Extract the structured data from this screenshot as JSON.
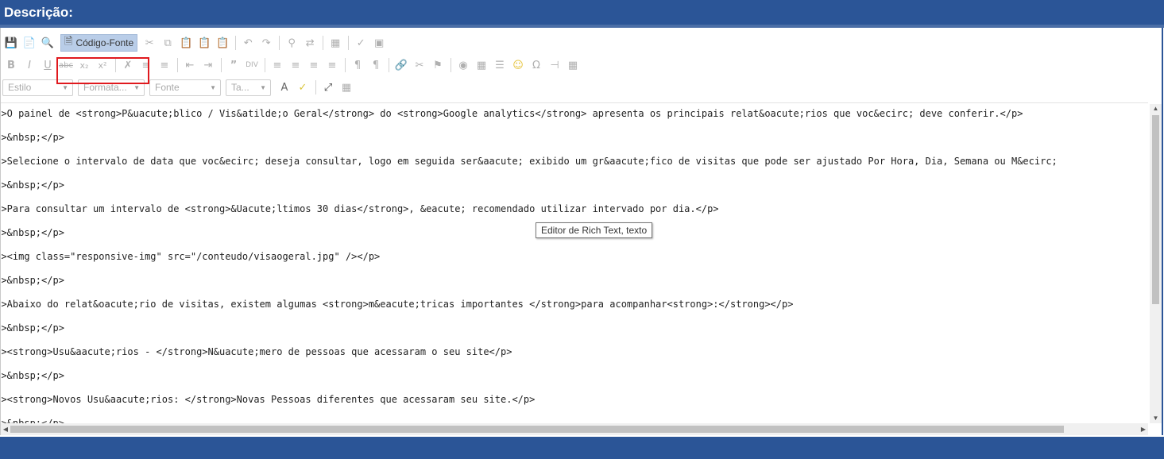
{
  "header": {
    "title": "Descrição:"
  },
  "toolbar": {
    "source_label": "Código-Fonte",
    "combos": {
      "style": "Estilo",
      "format": "Formata...",
      "font": "Fonte",
      "size": "Ta..."
    }
  },
  "content": {
    "lines": [
      "<p>O painel de <strong>P&uacute;blico / Vis&atilde;o Geral</strong> do <strong>Google analytics</strong> apresenta os principais relat&oacute;rios que voc&ecirc; deve conferir.</p>",
      "<p>&nbsp;</p>",
      "<p>Selecione o intervalo de data que voc&ecirc; deseja consultar, logo em seguida ser&aacute; exibido um gr&aacute;fico de visitas que pode ser ajustado Por Hora, Dia, Semana ou M&ecirc;",
      "<p>&nbsp;</p>",
      "<p>Para consultar um intervalo de <strong>&Uacute;ltimos 30 dias</strong>, &eacute; recomendado utilizar intervado por dia.</p>",
      "<p>&nbsp;</p>",
      "<p><img class=\"responsive-img\" src=\"/conteudo/visaogeral.jpg\" /></p>",
      "<p>&nbsp;</p>",
      "<p>Abaixo do relat&oacute;rio de visitas, existem algumas <strong>m&eacute;tricas importantes </strong>para acompanhar<strong>:</strong></p>",
      "<p>&nbsp;</p>",
      "<p><strong>Usu&aacute;rios - </strong>N&uacute;mero de pessoas que acessaram o seu site</p>",
      "<p>&nbsp;</p>",
      "<p><strong>Novos Usu&aacute;rios: </strong>Novas Pessoas diferentes que acessaram seu site.</p>",
      "<p>&nbsp;</p>"
    ]
  },
  "tooltip": {
    "text": "Editor de Rich Text, texto"
  }
}
